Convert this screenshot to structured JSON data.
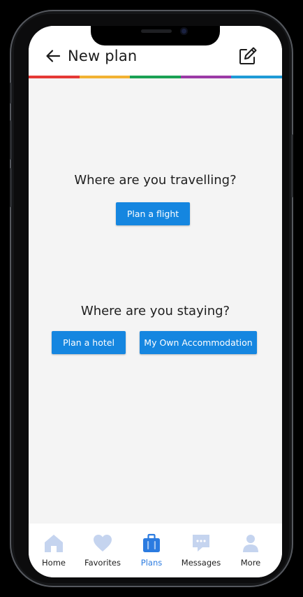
{
  "header": {
    "title": "New plan"
  },
  "accent_colors": [
    "#e53935",
    "#f2b233",
    "#1aa154",
    "#9b3aa6",
    "#1e9ad6"
  ],
  "main": {
    "travel_question": "Where are you travelling?",
    "flight_button": "Plan a flight",
    "stay_question": "Where are you staying?",
    "hotel_button": "Plan a hotel",
    "own_accommodation_button": "My Own Accommodation"
  },
  "nav": {
    "items": [
      {
        "label": "Home",
        "icon": "home-icon"
      },
      {
        "label": "Favorites",
        "icon": "heart-icon"
      },
      {
        "label": "Plans",
        "icon": "suitcase-icon",
        "active": true
      },
      {
        "label": "Messages",
        "icon": "chat-icon"
      },
      {
        "label": "More",
        "icon": "person-icon"
      }
    ]
  },
  "colors": {
    "primary_button": "#1586e0",
    "active_nav": "#2b7be0",
    "inactive_nav_icon": "#c5d4ef",
    "background": "#f4f4f4"
  }
}
